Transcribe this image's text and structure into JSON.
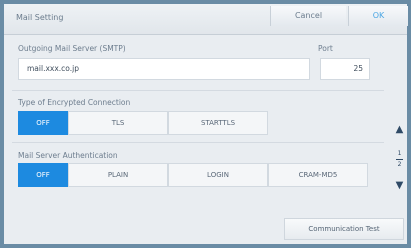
{
  "title": "Mail Setting",
  "cancel_label": "Cancel",
  "ok_label": "OK",
  "outgoing": {
    "label": "Outgoing Mail Server (SMTP)",
    "value": "mail.xxx.co.jp",
    "port_label": "Port",
    "port_value": "25"
  },
  "encryption": {
    "label": "Type of Encrypted Connection",
    "options": [
      "OFF",
      "TLS",
      "STARTTLS"
    ],
    "selected": "OFF"
  },
  "auth": {
    "label": "Mail Server Authentication",
    "options": [
      "OFF",
      "PLAIN",
      "LOGIN",
      "CRAM-MD5"
    ],
    "selected": "OFF"
  },
  "pager": {
    "current": "1",
    "total": "2"
  },
  "communication_test_label": "Communication Test",
  "colors": {
    "accent": "#1d8ae0",
    "ok_text": "#4aa6e4",
    "frame": "#6a8ca5"
  }
}
